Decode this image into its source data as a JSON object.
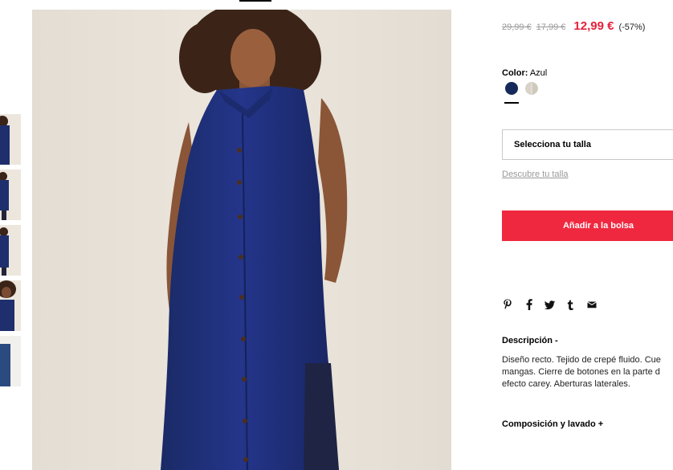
{
  "product": {
    "images": {
      "main_alt": "Vestido camisero azul",
      "thumbnail_count": 5
    },
    "pricing": {
      "original_price_1": "29,99 €",
      "original_price_2": "17,99 €",
      "current_price": "12,99 €",
      "discount": "(-57%)"
    },
    "color": {
      "label": "Color:",
      "value": "Azul",
      "swatches": [
        {
          "name": "Azul",
          "color": "#152a5a",
          "selected": true
        },
        {
          "name": "Beige",
          "color": "#d8d2c8",
          "selected": false
        }
      ]
    },
    "size": {
      "select_label": "Selecciona tu talla",
      "guide_link": "Descubre tu talla"
    },
    "cart": {
      "add_button": "Añadir a la bolsa"
    },
    "share": {
      "icons": [
        "pinterest-icon",
        "facebook-icon",
        "twitter-icon",
        "tumblr-icon",
        "email-icon"
      ]
    },
    "description": {
      "title": "Descripción -",
      "lines": [
        "Diseño recto. Tejido de crepé fluido. Cue",
        "mangas. Cierre de botones en la parte d",
        "efecto carey. Aberturas laterales."
      ]
    },
    "composition": {
      "title": "Composición y lavado +"
    }
  },
  "colors": {
    "accent_red": "#f0283f",
    "price_red": "#e5213b",
    "dress_navy": "#1f2f6d"
  }
}
